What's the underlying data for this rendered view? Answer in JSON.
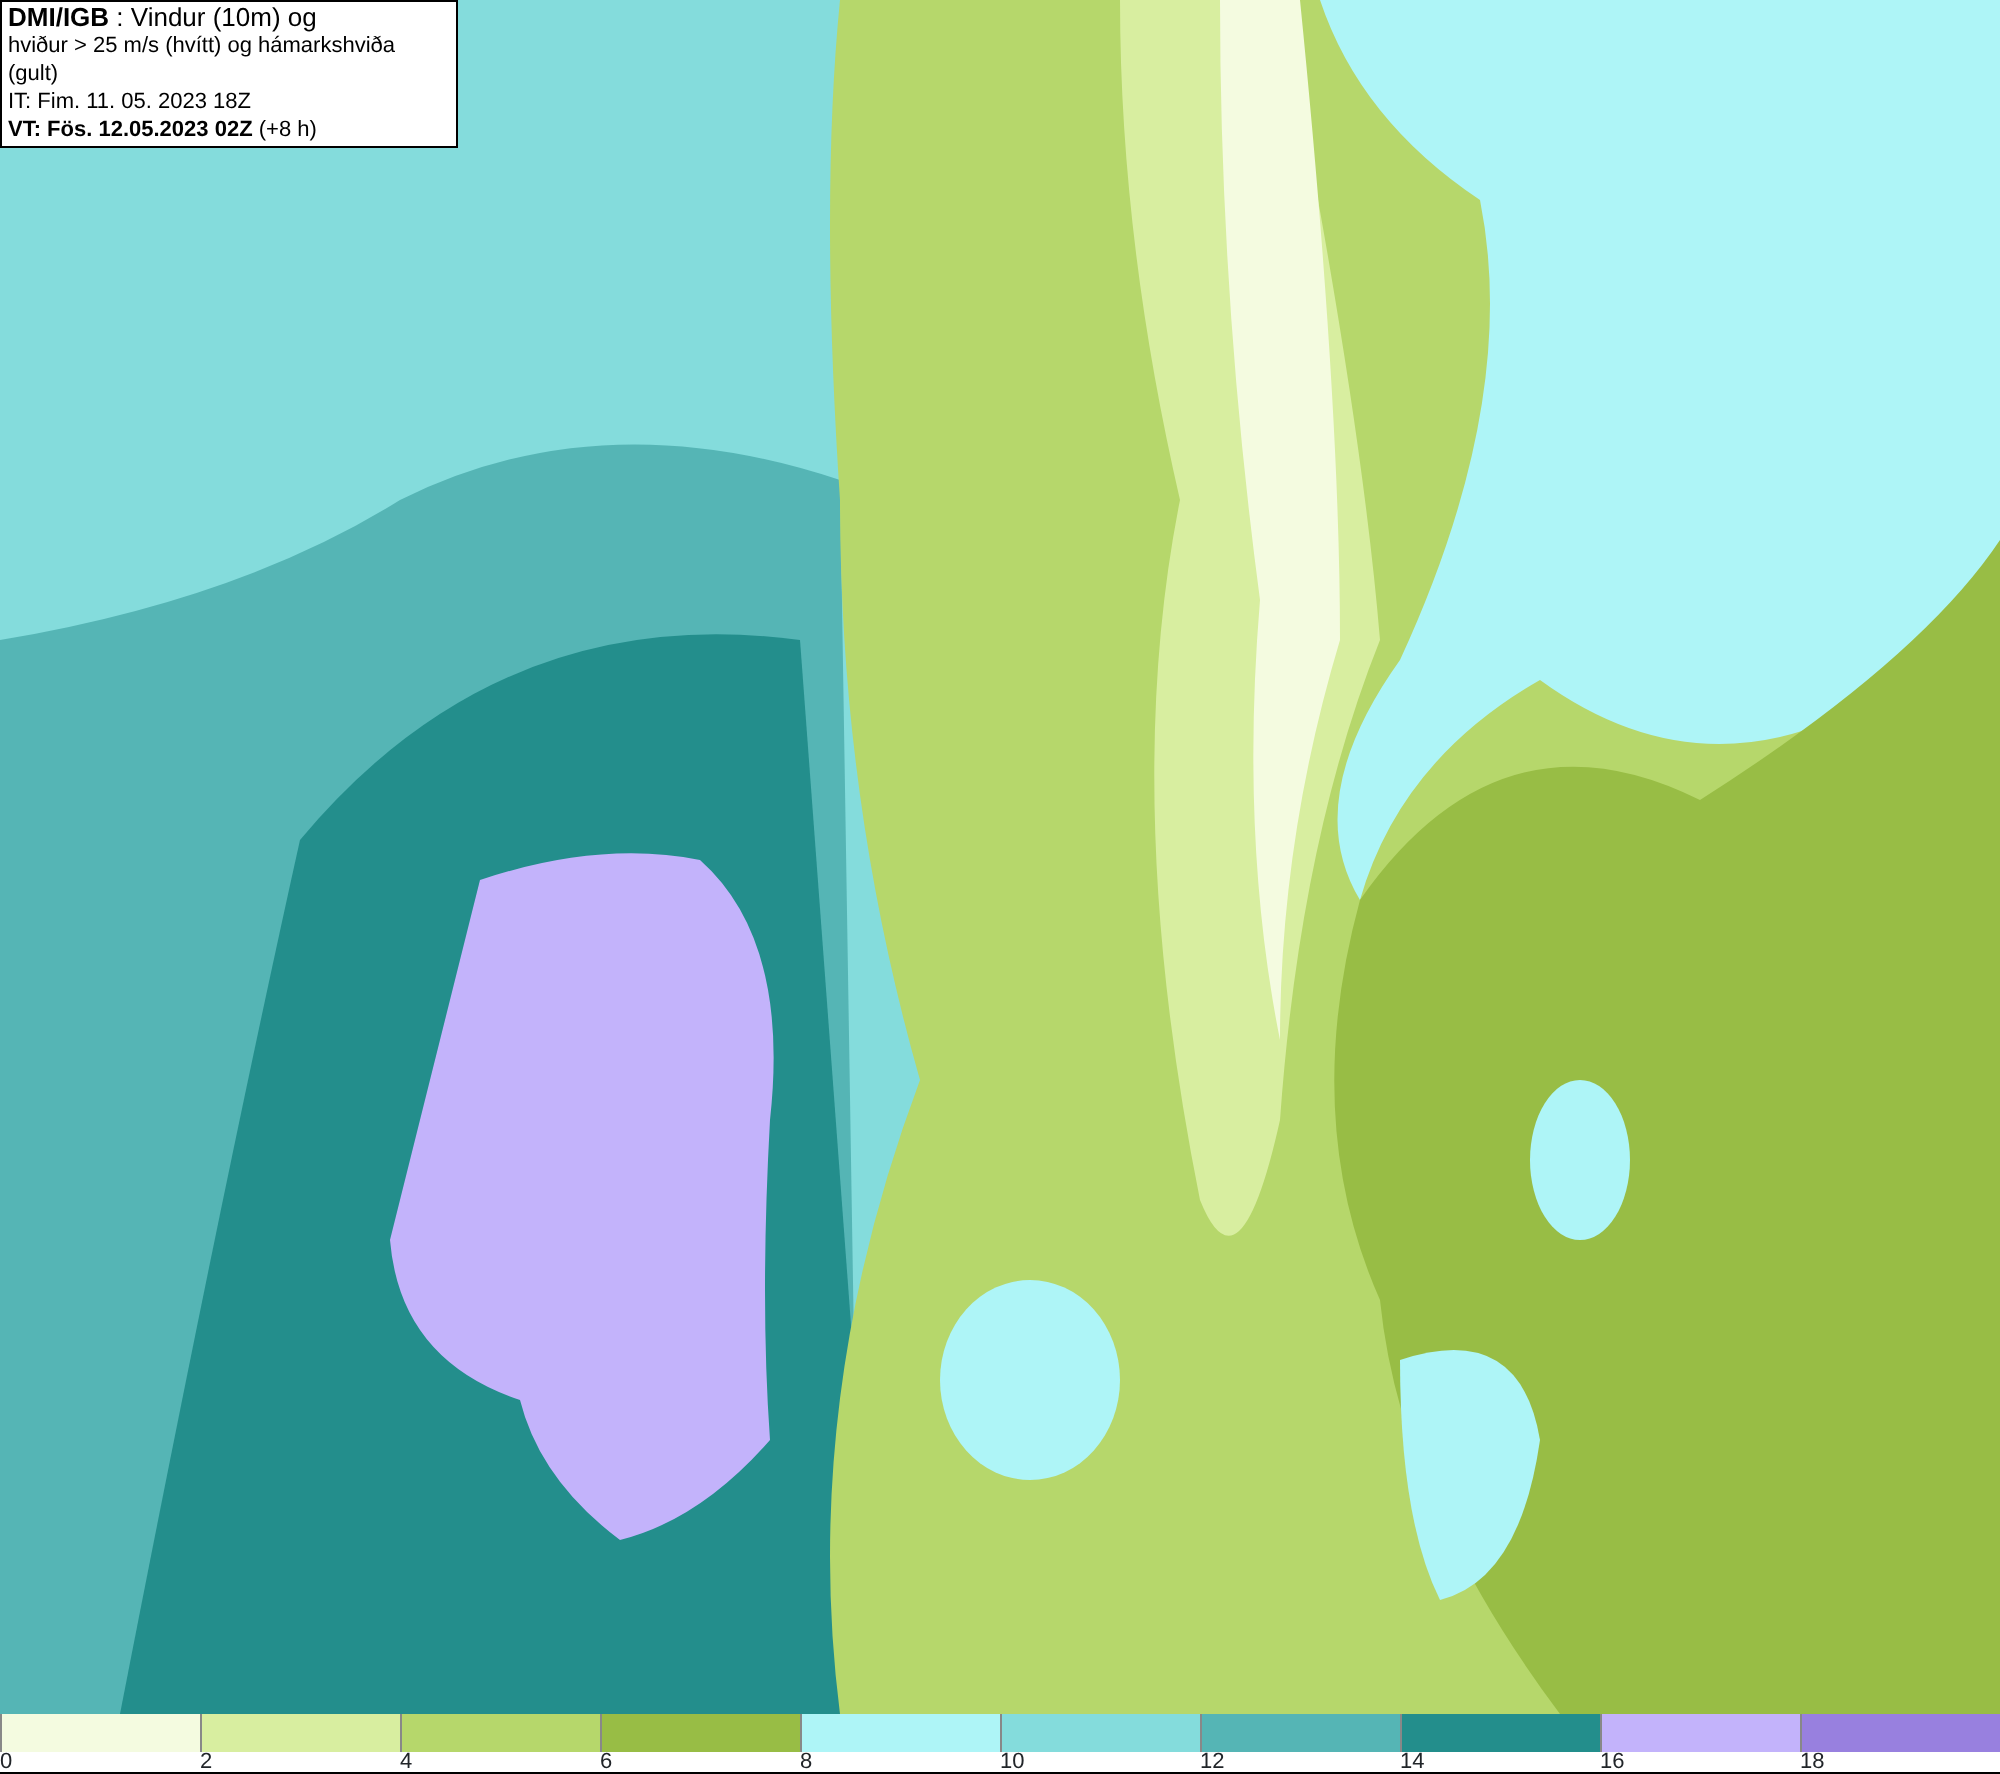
{
  "header": {
    "lines": [
      "**DMI/IGB** : Vindur (10m) og",
      "hviður > 25 m/s (hvítt) og hámarkshviða (gult)",
      "IT: Fim. 11. 05. 2023 18Z",
      "**VT: Fös. 12.05.2023 02Z** (+8 h)"
    ]
  },
  "legend": [
    {
      "label": "0",
      "color": "#f4fbe0"
    },
    {
      "label": "2",
      "color": "#d8eea0"
    },
    {
      "label": "4",
      "color": "#b6d76b"
    },
    {
      "label": "6",
      "color": "#98bd45"
    },
    {
      "label": "8",
      "color": "#aef5f7"
    },
    {
      "label": "10",
      "color": "#84dcdc"
    },
    {
      "label": "12",
      "color": "#55b5b5"
    },
    {
      "label": "14",
      "color": "#238e8c"
    },
    {
      "label": "16",
      "color": "#c3b3fb"
    },
    {
      "label": "18",
      "color": "#9880df"
    }
  ]
}
